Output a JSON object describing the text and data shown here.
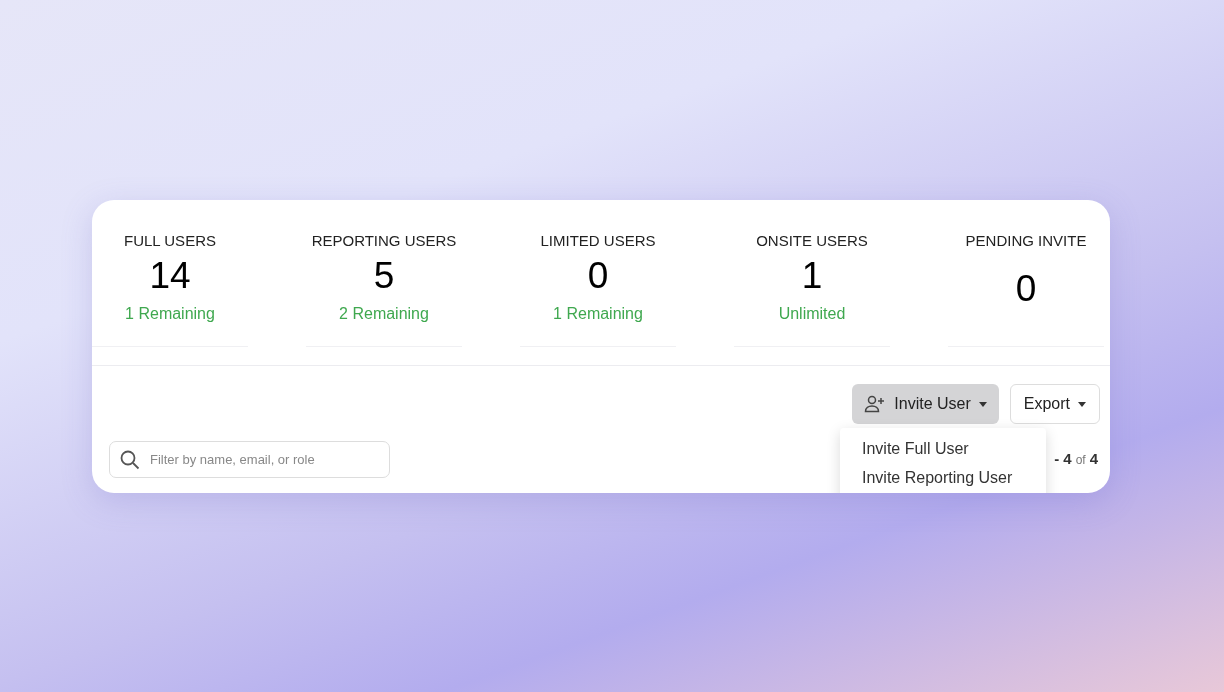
{
  "stats": [
    {
      "label": "FULL USERS",
      "value": "14",
      "note": "1 Remaining"
    },
    {
      "label": "REPORTING USERS",
      "value": "5",
      "note": "2 Remaining"
    },
    {
      "label": "LIMITED USERS",
      "value": "0",
      "note": "1 Remaining"
    },
    {
      "label": "ONSITE USERS",
      "value": "1",
      "note": "Unlimited"
    },
    {
      "label": "PENDING INVITE",
      "value": "0"
    }
  ],
  "invite_button": {
    "label": "Invite User",
    "expanded": true
  },
  "export_button": {
    "label": "Export"
  },
  "invite_menu": [
    "Invite Full User",
    "Invite Reporting User"
  ],
  "search": {
    "placeholder": "Filter by name, email, or role"
  },
  "pagination": {
    "range_end": "- 4",
    "separator": "of",
    "total": "4"
  }
}
